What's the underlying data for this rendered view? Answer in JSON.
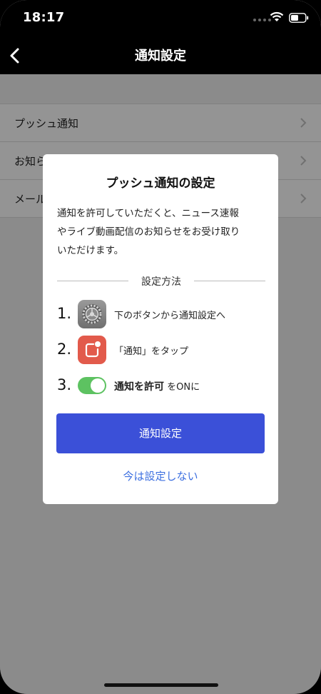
{
  "status_bar": {
    "time": "18:17"
  },
  "nav": {
    "title": "通知設定"
  },
  "list": {
    "items": [
      {
        "label": "プッシュ通知"
      },
      {
        "label": "お知らせ"
      },
      {
        "label": "メール"
      }
    ]
  },
  "dialog": {
    "title": "プッシュ通知の設定",
    "body_lines": [
      "通知を許可していただくと、ニュース速報",
      "やライブ動画配信のお知らせをお受け取り",
      "いただけます。"
    ],
    "section_label": "設定方法",
    "steps": [
      {
        "number": "1.",
        "icon": "settings-icon",
        "text": "下のボタンから通知設定へ"
      },
      {
        "number": "2.",
        "icon": "notification-app-icon",
        "text": "「通知」をタップ"
      },
      {
        "number": "3.",
        "icon": "toggle-on-icon",
        "bold_text": "通知を許可",
        "text": " をONに"
      }
    ],
    "primary_button": "通知設定",
    "secondary_link": "今は設定しない"
  },
  "colors": {
    "primary_button": "#3b50d8",
    "link": "#3c6fe0",
    "toggle_on": "#5dc261",
    "notification_icon": "#e25a4b"
  }
}
